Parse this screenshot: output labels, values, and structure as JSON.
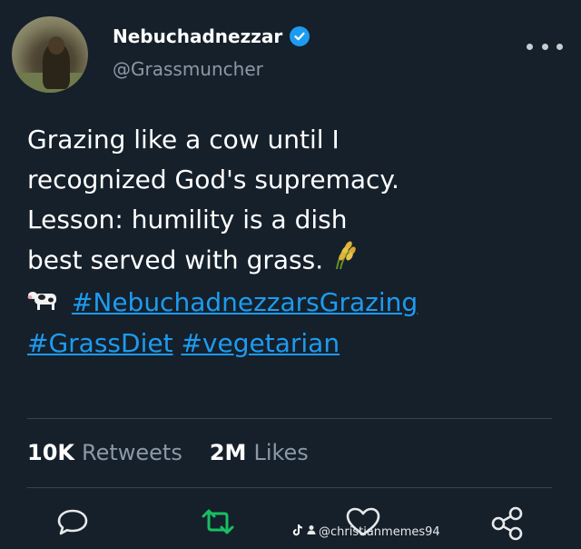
{
  "user": {
    "name": "Nebuchadnezzar",
    "handle": "@Grassmuncher"
  },
  "tweet": {
    "lines": [
      "Grazing like a cow until I",
      "recognized God's supremacy.",
      "Lesson: humility is a dish",
      "best served with grass."
    ],
    "hashtags": [
      "#NebuchadnezzarsGrazing",
      "#GrassDiet",
      "#vegetarian"
    ]
  },
  "stats": {
    "retweets_count": "10K",
    "retweets_label": "Retweets",
    "likes_count": "2M",
    "likes_label": "Likes"
  },
  "watermark": {
    "text": "@christianmemes94"
  },
  "colors": {
    "background": "#15202b",
    "link": "#1d9bf0",
    "muted": "#8b98a5",
    "retweet_green": "#17bf63"
  },
  "icons": [
    "verified-badge-icon",
    "more-options-icon",
    "rice-emoji-icon",
    "cow-emoji-icon",
    "reply-icon",
    "retweet-icon",
    "like-icon",
    "share-icon",
    "tiktok-icon",
    "user-icon"
  ]
}
